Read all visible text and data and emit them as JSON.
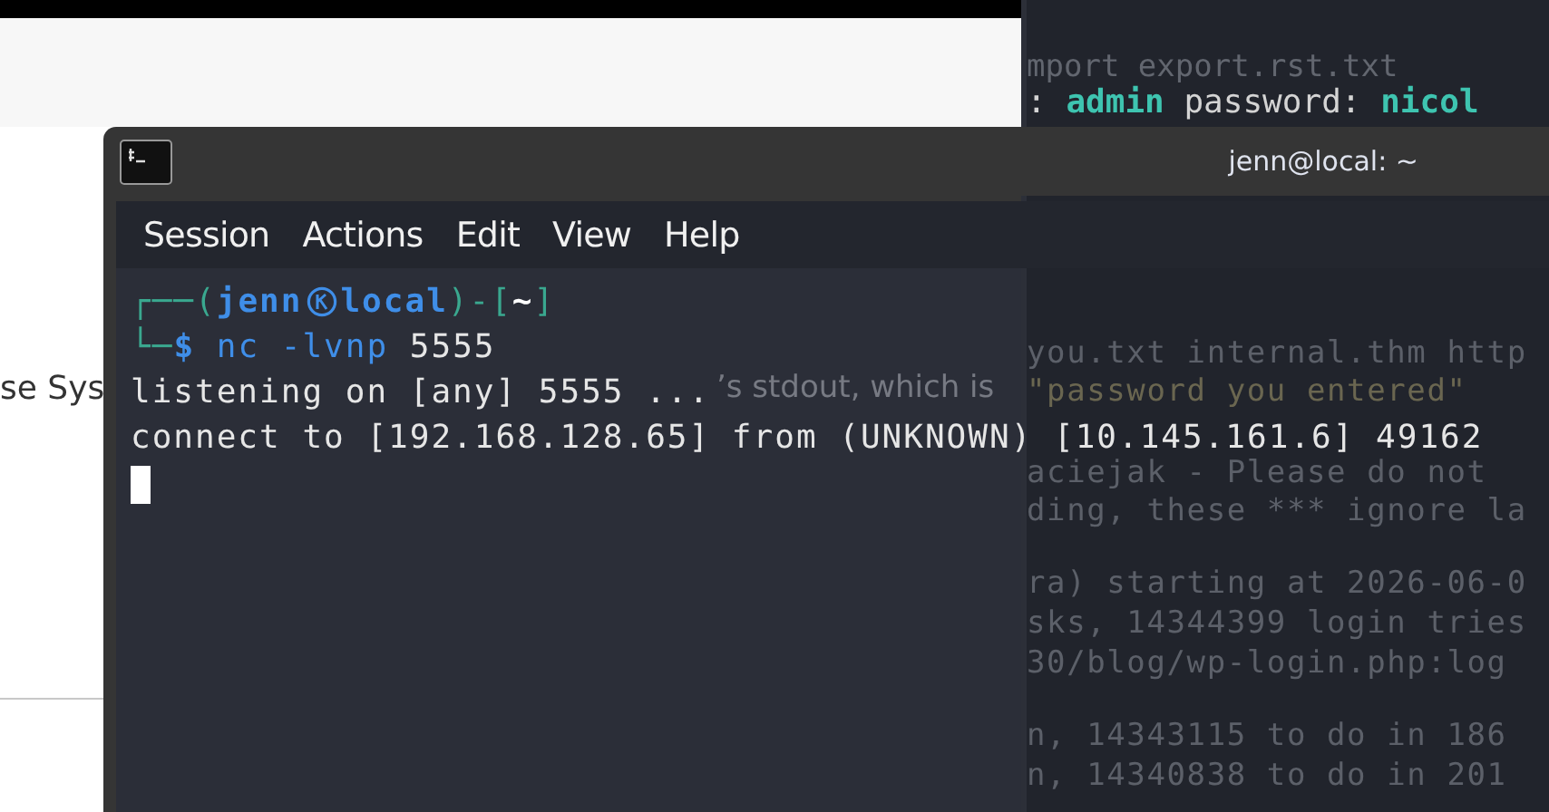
{
  "background_page": {
    "texts": [
      "se Sys",
      "’s stdout, which is"
    ]
  },
  "background_terminal": {
    "top_lines": [
      {
        "kind": "faint",
        "segments": [
          {
            "text": "mport export.rst.txt",
            "kind": "plain"
          }
        ]
      },
      {
        "kind": "bright",
        "segments": [
          {
            "text": ": ",
            "kind": "plain"
          },
          {
            "text": "admin",
            "kind": "highlight"
          },
          {
            "text": "   password: ",
            "kind": "plain"
          },
          {
            "text": "nicol",
            "kind": "highlight"
          }
        ]
      }
    ],
    "blocks": [
      {
        "lines": [
          {
            "text": "you.txt internal.thm http",
            "kind": "plain"
          },
          {
            "text": " \"password you entered\"",
            "kind": "quoted"
          },
          {
            "text": "aciejak - Please do not",
            "kind": "plain"
          },
          {
            "text": "ding, these *** ignore la",
            "kind": "plain"
          }
        ]
      },
      {
        "lines": [
          {
            "text": "ra) starting at 2026-06-0",
            "kind": "plain"
          },
          {
            "text": "sks, 14344399 login tries",
            "kind": "plain"
          },
          {
            "text": "30/blog/wp-login.php:log",
            "kind": "plain"
          }
        ]
      },
      {
        "lines": [
          {
            "text": "n, 14343115 to do in 186",
            "kind": "plain"
          },
          {
            "text": "n, 14340838 to do in 201",
            "kind": "plain"
          }
        ]
      }
    ]
  },
  "terminal": {
    "title": "jenn@local: ~",
    "menu": [
      "Session",
      "Actions",
      "Edit",
      "View",
      "Help"
    ],
    "prompt": {
      "open": "┌──(",
      "user": "jenn",
      "host": "local",
      "middle": ")-[",
      "dir": "~",
      "close": "]",
      "corner": "└─",
      "symbol": "$"
    },
    "command": {
      "program": "nc -lvnp",
      "argument": "5555"
    },
    "output": [
      "listening on [any] 5555 ...",
      "connect to [192.168.128.65] from (UNKNOWN) [10.145.161.6] 49162"
    ],
    "cursor_visible": true
  }
}
